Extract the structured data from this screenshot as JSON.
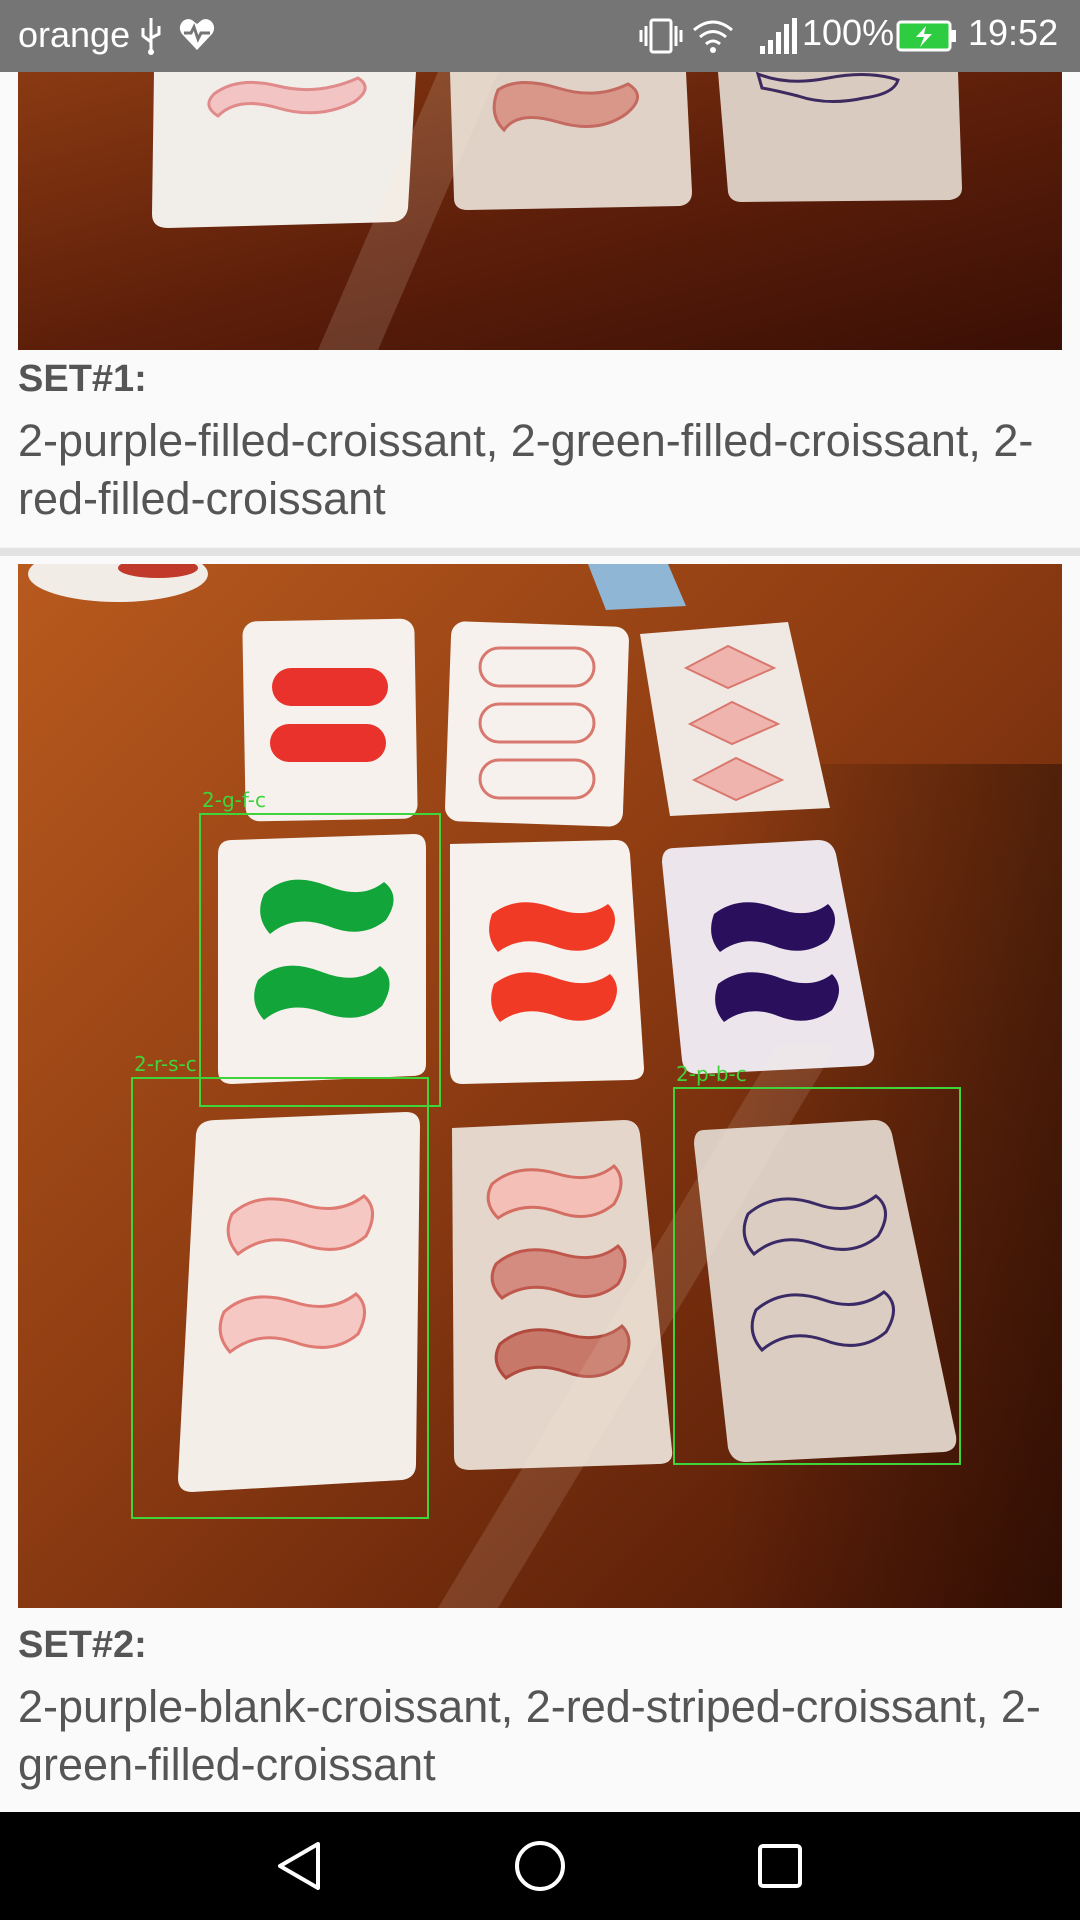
{
  "status_bar": {
    "carrier": "orange",
    "battery": "100%",
    "time": "19:52",
    "icons": [
      "usb-icon",
      "health-icon",
      "vibrate-icon",
      "wifi-icon",
      "signal-icon",
      "battery-charging-icon"
    ]
  },
  "results": [
    {
      "title": "SET#1:",
      "cards": "2-purple-filled-croissant, 2-green-filled-croissant, 2-red-filled-croissant"
    },
    {
      "title": "SET#2:",
      "cards": "2-purple-blank-croissant, 2-red-striped-croissant, 2-green-filled-croissant",
      "detections": [
        "2-g-f-c",
        "2-r-s-c",
        "2-p-b-c"
      ]
    }
  ],
  "navigation": {
    "buttons": [
      "back-icon",
      "home-icon",
      "recents-icon"
    ]
  },
  "colors": {
    "status_bar": "#757575",
    "detection_box": "#3fd43a",
    "nav_bar": "#000000"
  }
}
